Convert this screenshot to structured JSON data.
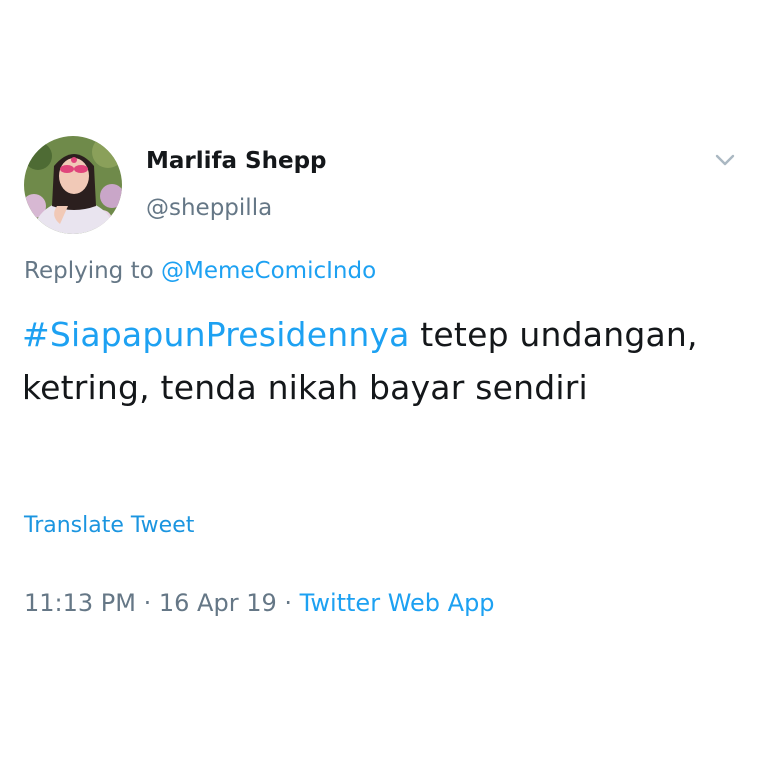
{
  "colors": {
    "accent": "#1da1f2",
    "secondary_text": "#657786",
    "primary_text": "#14171a",
    "background": "#ffffff"
  },
  "author": {
    "display_name": "Marlifa Shepp",
    "handle": "@sheppilla",
    "avatar_icon": "profile-photo"
  },
  "menu": {
    "icon": "chevron-down-icon"
  },
  "reply": {
    "prefix": "Replying to ",
    "mention": "@MemeComicIndo"
  },
  "tweet": {
    "hashtag": "#SiapapunPresidennya",
    "text_rest": " tetep undangan, ketring, tenda nikah bayar sendiri"
  },
  "translate_label": "Translate Tweet",
  "meta": {
    "time": "11:13 PM",
    "date": "16 Apr 19",
    "separator": " · ",
    "source": "Twitter Web App"
  }
}
